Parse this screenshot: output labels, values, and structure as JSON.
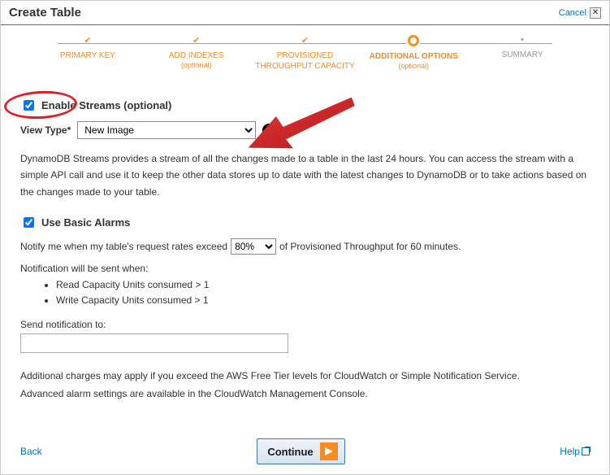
{
  "header": {
    "title": "Create Table",
    "cancel": "Cancel"
  },
  "wizard": {
    "steps": [
      {
        "label": "PRIMARY KEY",
        "sub": ""
      },
      {
        "label": "ADD INDEXES",
        "sub": "(optional)"
      },
      {
        "label": "PROVISIONED THROUGHPUT CAPACITY",
        "sub": ""
      },
      {
        "label": "ADDITIONAL OPTIONS",
        "sub": "(optional)"
      },
      {
        "label": "SUMMARY",
        "sub": ""
      }
    ]
  },
  "streams": {
    "enable_label": "Enable Streams (optional)",
    "view_type_label": "View Type*",
    "view_type_value": "New Image",
    "description": "DynamoDB Streams provides a stream of all the changes made to a table in the last 24 hours. You can access the stream with a simple API call and use it to keep the other data stores up to date with the latest changes to DynamoDB or to take actions based on the changes made to your table."
  },
  "alarms": {
    "use_label": "Use Basic Alarms",
    "notify_pre": "Notify me when my table's request rates exceed",
    "percent": "80%",
    "notify_post": "of Provisioned Throughput for 60 minutes.",
    "sent_when": "Notification will be sent when:",
    "bullets": [
      "Read Capacity Units consumed > 1",
      "Write Capacity Units consumed > 1"
    ],
    "send_to_label": "Send notification to:",
    "send_to_value": "",
    "charges_note": "Additional charges may apply if you exceed the AWS Free Tier levels for CloudWatch or Simple Notification Service.",
    "advanced_note": "Advanced alarm settings are available in the CloudWatch Management Console."
  },
  "footer": {
    "back": "Back",
    "continue": "Continue",
    "help": "Help"
  }
}
